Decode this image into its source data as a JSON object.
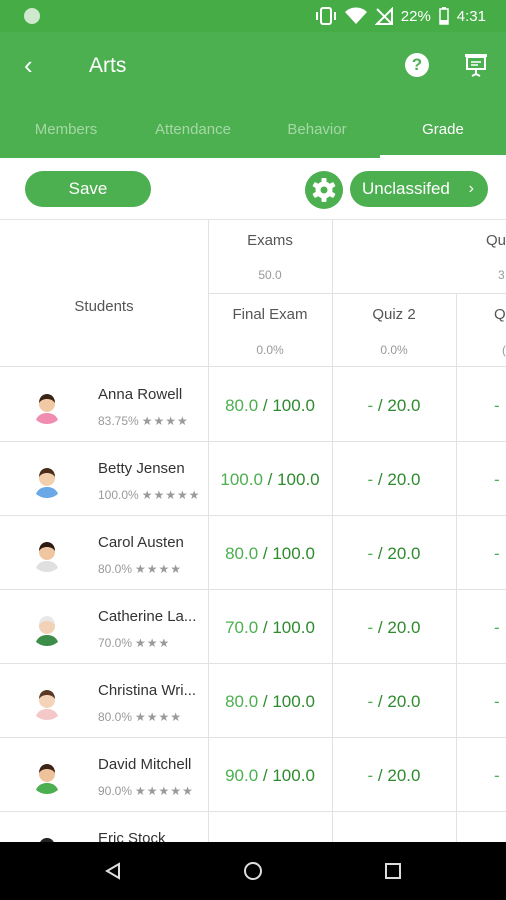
{
  "status": {
    "battery": "22%",
    "time": "4:31"
  },
  "header": {
    "title": "Arts"
  },
  "tabs": [
    {
      "label": "Members"
    },
    {
      "label": "Attendance"
    },
    {
      "label": "Behavior"
    },
    {
      "label": "Grade"
    }
  ],
  "active_tab": "Grade",
  "toolbar": {
    "save_label": "Save",
    "category_label": "Unclassifed"
  },
  "table": {
    "students_header": "Students",
    "group1": {
      "name": "Exams",
      "weight": "50.0"
    },
    "group2": {
      "name": "Qu",
      "weight": "3"
    },
    "columns": [
      {
        "name": "Final Exam",
        "weight": "0.0%"
      },
      {
        "name": "Quiz 2",
        "weight": "0.0%"
      },
      {
        "name": "Q",
        "weight": "("
      }
    ],
    "rows": [
      {
        "name": "Anna Rowell",
        "percent": "83.75%",
        "stars": "★★★★",
        "final_score": "80.0",
        "final_max": " / 100.0",
        "quiz_score": "-",
        "quiz_max": " / 20.0",
        "next": "-"
      },
      {
        "name": "Betty Jensen",
        "percent": "100.0%",
        "stars": "★★★★★",
        "final_score": "100.0",
        "final_max": " / 100.0",
        "quiz_score": "-",
        "quiz_max": " / 20.0",
        "next": "-"
      },
      {
        "name": "Carol Austen",
        "percent": "80.0%",
        "stars": "★★★★",
        "final_score": "80.0",
        "final_max": " / 100.0",
        "quiz_score": "-",
        "quiz_max": " / 20.0",
        "next": "-"
      },
      {
        "name": "Catherine La...",
        "percent": "70.0%",
        "stars": "★★★",
        "final_score": "70.0",
        "final_max": " / 100.0",
        "quiz_score": "-",
        "quiz_max": " / 20.0",
        "next": "-"
      },
      {
        "name": "Christina Wri...",
        "percent": "80.0%",
        "stars": "★★★★",
        "final_score": "80.0",
        "final_max": " / 100.0",
        "quiz_score": "-",
        "quiz_max": " / 20.0",
        "next": "-"
      },
      {
        "name": "David Mitchell",
        "percent": "90.0%",
        "stars": "★★★★★",
        "final_score": "90.0",
        "final_max": " / 100.0",
        "quiz_score": "-",
        "quiz_max": " / 20.0",
        "next": "-"
      },
      {
        "name": "Eric Stock",
        "percent": "",
        "stars": "",
        "final_score": "",
        "final_max": "",
        "quiz_score": "",
        "quiz_max": "",
        "next": ""
      }
    ]
  },
  "colors": {
    "primary": "#4caf50",
    "status_bar": "#46ad46",
    "score_green": "#4caf50"
  }
}
